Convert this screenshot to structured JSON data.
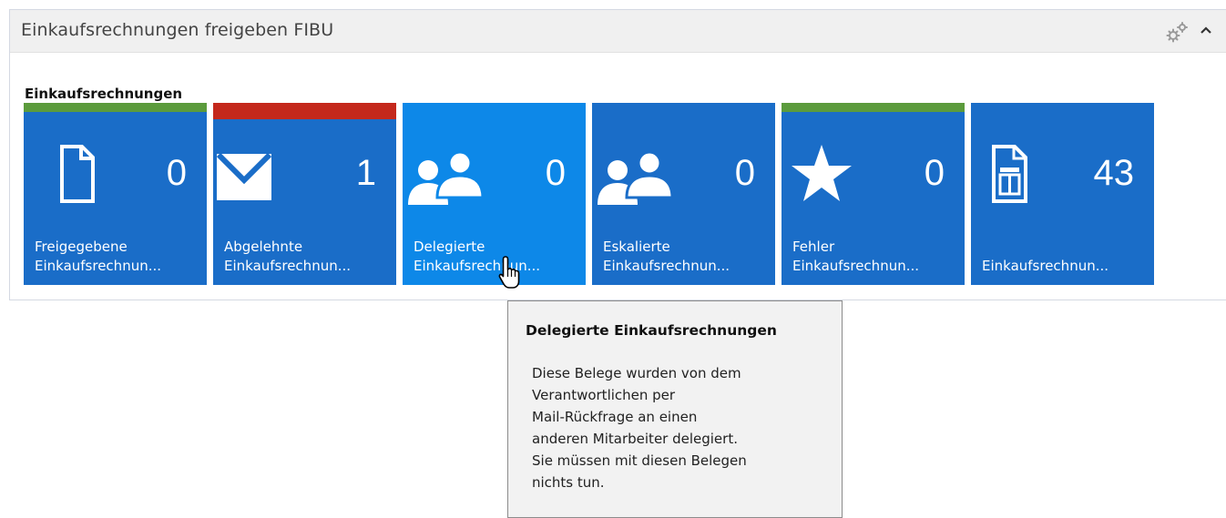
{
  "panel": {
    "title": "Einkaufsrechnungen freigeben FIBU",
    "header_icons": [
      "gear-icon",
      "chevron-up-icon"
    ]
  },
  "group": {
    "title": "Einkaufsrechnungen"
  },
  "tiles": [
    {
      "icon": "document-icon",
      "count": "0",
      "label": "Freigegebene\nEinkaufsrechnun...",
      "stripe_color": "#5b9b3c"
    },
    {
      "icon": "envelope-icon",
      "count": "1",
      "label": "Abgelehnte\nEinkaufsrechnun...",
      "stripe_color": "#c4281c"
    },
    {
      "icon": "users-icon",
      "count": "0",
      "label": "Delegierte\nEinkaufsrechnun...",
      "stripe_color": null
    },
    {
      "icon": "users-icon",
      "count": "0",
      "label": "Eskalierte\nEinkaufsrechnun...",
      "stripe_color": null
    },
    {
      "icon": "star-icon",
      "count": "0",
      "label": "Fehler\nEinkaufsrechnun...",
      "stripe_color": "#5b9b3c"
    },
    {
      "icon": "invoice-icon",
      "count": "43",
      "label": "Einkaufsrechnun...",
      "stripe_color": null
    }
  ],
  "tooltip": {
    "title": "Delegierte Einkaufsrechnungen",
    "body": "Diese Belege wurden von dem\nVerantwortlichen per\nMail-Rückfrage an einen\nanderen Mitarbeiter delegiert.\nSie müssen mit diesen Belegen\nnichts tun."
  },
  "colors": {
    "tile_background": "#1a6dc8",
    "tile_hover_background": "#0d88e8",
    "stripe_green": "#5b9b3c",
    "stripe_red": "#c4281c"
  }
}
